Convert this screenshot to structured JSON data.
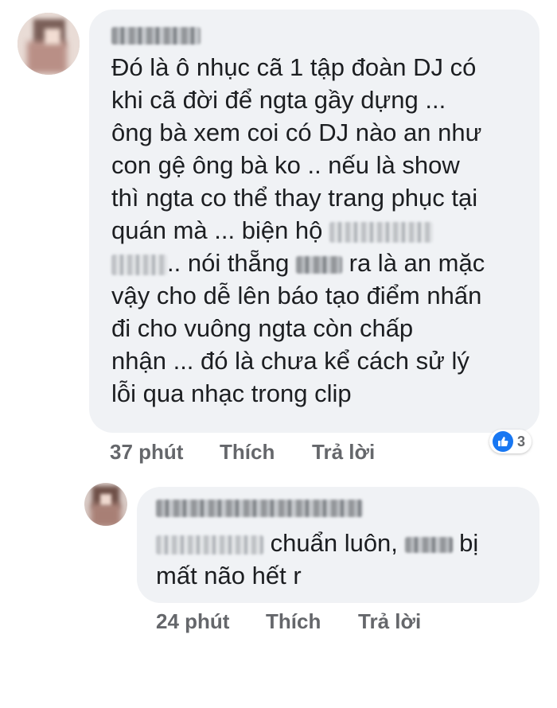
{
  "comments": [
    {
      "author_blurred": true,
      "lines": [
        [
          "Đó là ô nhục cã 1 tập đoàn DJ có"
        ],
        [
          "khi cã đời để ngta gầy dựng ..."
        ],
        [
          "ông bà xem coi có DJ nào an  như"
        ],
        [
          "con gệ ông bà ko .. nếu là show"
        ],
        [
          "thì ngta co thể thay trang phục tại"
        ],
        [
          "quán mà ... biện hộ "
        ],
        [
          ".. nói thẵng ",
          " ra là an mặc"
        ],
        [
          "vậy cho dễ lên báo tạo điểm nhấn"
        ],
        [
          "đi cho vuông ngta còn chấp"
        ],
        [
          "nhận ... đó là chưa kể cách sử lý"
        ],
        [
          "lỗi qua nhạc trong clip"
        ]
      ],
      "time": "37 phút",
      "like_label": "Thích",
      "reply_label": "Trả lời",
      "reaction": {
        "icon": "thumbs-up-icon",
        "count": "3"
      }
    },
    {
      "author_blurred": true,
      "line1_text": " chuẩn luôn, ",
      "line1_end": " bị",
      "line2": "mất não hết r",
      "time": "24 phút",
      "like_label": "Thích",
      "reply_label": "Trả lời"
    }
  ],
  "colors": {
    "bubble": "#f0f2f5",
    "meta": "#65676b",
    "like": "#1877f2"
  }
}
